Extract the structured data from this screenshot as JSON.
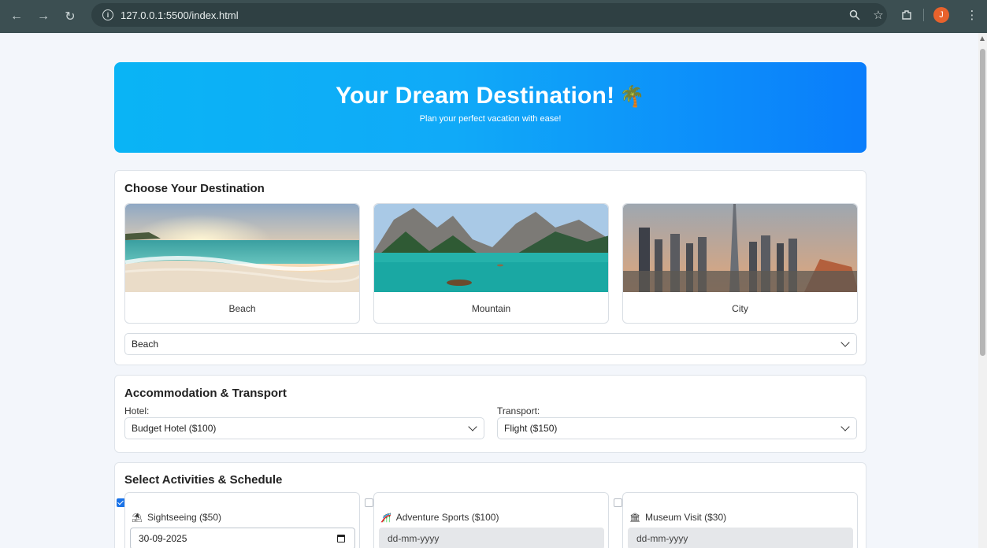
{
  "browser": {
    "url": "127.0.0.1:5500/index.html",
    "profile_initial": "J"
  },
  "hero": {
    "title": "Your Dream Destination!",
    "subtitle": "Plan your perfect vacation with ease!"
  },
  "destinations": {
    "heading": "Choose Your Destination",
    "items": [
      {
        "label": "Beach"
      },
      {
        "label": "Mountain"
      },
      {
        "label": "City"
      }
    ],
    "selected": "Beach"
  },
  "accommodation": {
    "heading": "Accommodation & Transport",
    "hotel_label": "Hotel:",
    "hotel_value": "Budget Hotel ($100)",
    "transport_label": "Transport:",
    "transport_value": "Flight ($150)"
  },
  "activities": {
    "heading": "Select Activities & Schedule",
    "items": [
      {
        "label": "Sightseeing ($50)",
        "checked": true,
        "date": "30-09-2025",
        "icon": "sightseeing-icon"
      },
      {
        "label": "Adventure Sports ($100)",
        "checked": false,
        "date": "dd-mm-yyyy",
        "icon": "adventure-icon"
      },
      {
        "label": "Museum Visit ($30)",
        "checked": false,
        "date": "dd-mm-yyyy",
        "icon": "museum-icon"
      }
    ]
  },
  "colors": {
    "hero_start": "#0ab4f5",
    "hero_end": "#0a7dfb",
    "checkbox": "#1a73e8",
    "browser_bar": "#3c4f52"
  }
}
